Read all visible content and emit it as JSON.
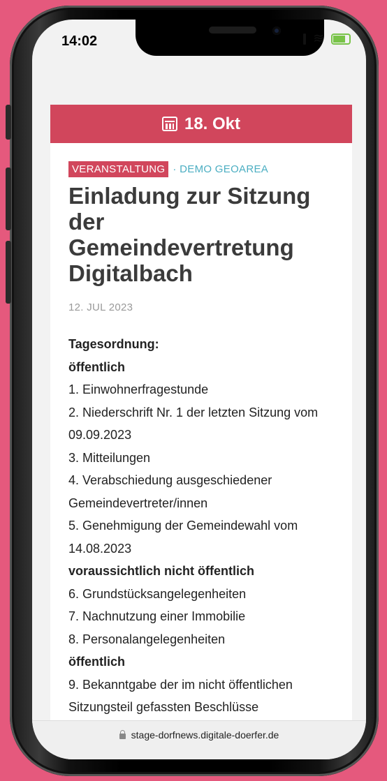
{
  "status_bar": {
    "time": "14:02"
  },
  "event": {
    "date_label": "18. Okt",
    "category": "VERANSTALTUNG",
    "geo_area": "· DEMO GEOAREA",
    "title": "Einladung zur Sitzung der Gemeindevertretung Digitalbach",
    "published": "12. JUL 2023"
  },
  "agenda": {
    "heading": "Tagesordnung:",
    "sections": [
      {
        "heading": "öffentlich",
        "items": [
          "1. Einwohnerfragestunde",
          "2. Niederschrift Nr. 1 der letzten Sitzung vom 09.09.2023",
          "3. Mitteilungen",
          "4. Verabschiedung ausgeschiedener Gemeindevertreter/innen",
          "5. Genehmigung der Gemeindewahl vom 14.08.2023"
        ]
      },
      {
        "heading": "voraussichtlich nicht öffentlich",
        "items": [
          "6. Grundstücksangelegenheiten",
          "7. Nachnutzung einer Immobilie",
          "8. Personalangelegenheiten"
        ]
      },
      {
        "heading": "öffentlich",
        "items": [
          "9. Bekanntgabe der im nicht öffentlichen Sitzungsteil gefassten Beschlüsse"
        ]
      }
    ]
  },
  "browser": {
    "url": "stage-dorfnews.digitale-doerfer.de"
  },
  "colors": {
    "background": "#e5597d",
    "accent": "#d1465c",
    "geo": "#4baec2"
  }
}
